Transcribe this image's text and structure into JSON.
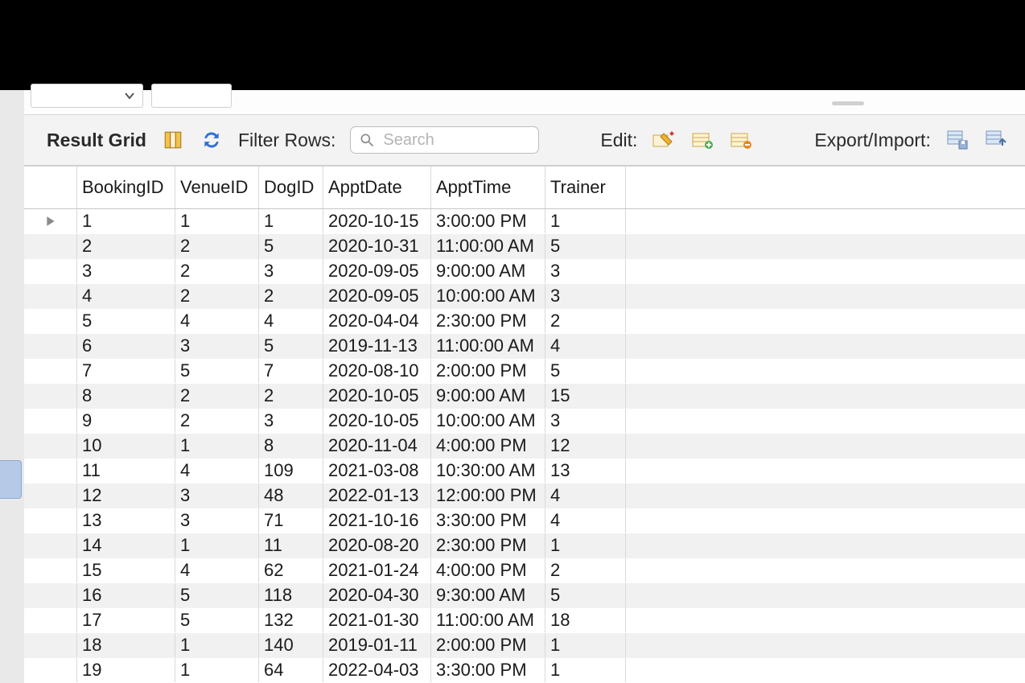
{
  "toolbar": {
    "result_grid_label": "Result Grid",
    "filter_rows_label": "Filter Rows:",
    "search_placeholder": "Search",
    "edit_label": "Edit:",
    "export_import_label": "Export/Import:"
  },
  "columns": {
    "c0": "BookingID",
    "c1": "VenueID",
    "c2": "DogID",
    "c3": "ApptDate",
    "c4": "ApptTime",
    "c5": "Trainer"
  },
  "rows": [
    {
      "BookingID": "1",
      "VenueID": "1",
      "DogID": "1",
      "ApptDate": "2020-10-15",
      "ApptTime": "3:00:00 PM",
      "Trainer": "1",
      "current": true
    },
    {
      "BookingID": "2",
      "VenueID": "2",
      "DogID": "5",
      "ApptDate": "2020-10-31",
      "ApptTime": "11:00:00 AM",
      "Trainer": "5"
    },
    {
      "BookingID": "3",
      "VenueID": "2",
      "DogID": "3",
      "ApptDate": "2020-09-05",
      "ApptTime": "9:00:00 AM",
      "Trainer": "3"
    },
    {
      "BookingID": "4",
      "VenueID": "2",
      "DogID": "2",
      "ApptDate": "2020-09-05",
      "ApptTime": "10:00:00 AM",
      "Trainer": "3"
    },
    {
      "BookingID": "5",
      "VenueID": "4",
      "DogID": "4",
      "ApptDate": "2020-04-04",
      "ApptTime": "2:30:00 PM",
      "Trainer": "2"
    },
    {
      "BookingID": "6",
      "VenueID": "3",
      "DogID": "5",
      "ApptDate": "2019-11-13",
      "ApptTime": "11:00:00 AM",
      "Trainer": "4"
    },
    {
      "BookingID": "7",
      "VenueID": "5",
      "DogID": "7",
      "ApptDate": "2020-08-10",
      "ApptTime": "2:00:00 PM",
      "Trainer": "5"
    },
    {
      "BookingID": "8",
      "VenueID": "2",
      "DogID": "2",
      "ApptDate": "2020-10-05",
      "ApptTime": "9:00:00 AM",
      "Trainer": "15"
    },
    {
      "BookingID": "9",
      "VenueID": "2",
      "DogID": "3",
      "ApptDate": "2020-10-05",
      "ApptTime": "10:00:00 AM",
      "Trainer": "3"
    },
    {
      "BookingID": "10",
      "VenueID": "1",
      "DogID": "8",
      "ApptDate": "2020-11-04",
      "ApptTime": "4:00:00 PM",
      "Trainer": "12"
    },
    {
      "BookingID": "11",
      "VenueID": "4",
      "DogID": "109",
      "ApptDate": "2021-03-08",
      "ApptTime": "10:30:00 AM",
      "Trainer": "13"
    },
    {
      "BookingID": "12",
      "VenueID": "3",
      "DogID": "48",
      "ApptDate": "2022-01-13",
      "ApptTime": "12:00:00 PM",
      "Trainer": "4"
    },
    {
      "BookingID": "13",
      "VenueID": "3",
      "DogID": "71",
      "ApptDate": "2021-10-16",
      "ApptTime": "3:30:00 PM",
      "Trainer": "4"
    },
    {
      "BookingID": "14",
      "VenueID": "1",
      "DogID": "11",
      "ApptDate": "2020-08-20",
      "ApptTime": "2:30:00 PM",
      "Trainer": "1"
    },
    {
      "BookingID": "15",
      "VenueID": "4",
      "DogID": "62",
      "ApptDate": "2021-01-24",
      "ApptTime": "4:00:00 PM",
      "Trainer": "2"
    },
    {
      "BookingID": "16",
      "VenueID": "5",
      "DogID": "118",
      "ApptDate": "2020-04-30",
      "ApptTime": "9:30:00 AM",
      "Trainer": "5"
    },
    {
      "BookingID": "17",
      "VenueID": "5",
      "DogID": "132",
      "ApptDate": "2021-01-30",
      "ApptTime": "11:00:00 AM",
      "Trainer": "18"
    },
    {
      "BookingID": "18",
      "VenueID": "1",
      "DogID": "140",
      "ApptDate": "2019-01-11",
      "ApptTime": "2:00:00 PM",
      "Trainer": "1"
    },
    {
      "BookingID": "19",
      "VenueID": "1",
      "DogID": "64",
      "ApptDate": "2022-04-03",
      "ApptTime": "3:30:00 PM",
      "Trainer": "1"
    }
  ]
}
